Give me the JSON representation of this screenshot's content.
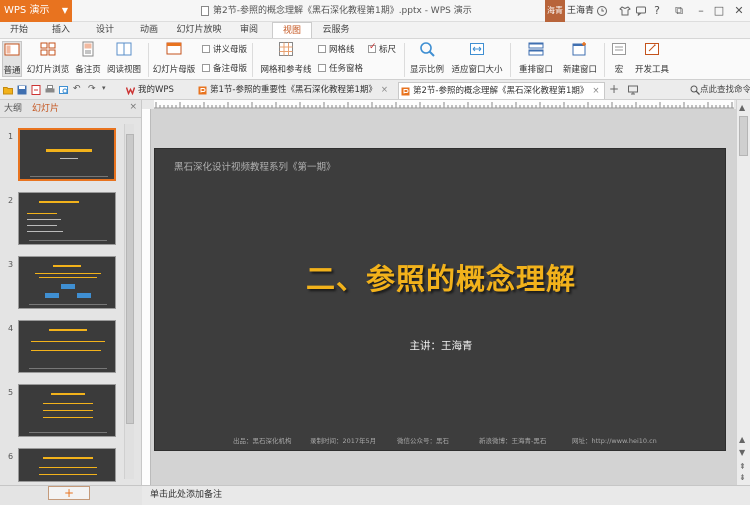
{
  "titlebar": {
    "app_label": "WPS 演示",
    "document_title": "第2节-参照的概念理解《黑石深化教程第1期》.pptx - WPS 演示",
    "avatar_text": "海青",
    "user_name": "王海青"
  },
  "menu": {
    "tabs": [
      "开始",
      "插入",
      "设计",
      "动画",
      "幻灯片放映",
      "审阅",
      "视图",
      "云服务"
    ],
    "active": "视图"
  },
  "ribbon": {
    "normal": "普通",
    "slide_sorter": "幻灯片浏览",
    "notes_page": "备注页",
    "reading_view": "阅读视图",
    "slide_master": "幻灯片母版",
    "handout_master": "讲义母版",
    "notes_master": "备注母版",
    "grid_guides": "网格和参考线",
    "gridlines": "网格线",
    "task_pane": "任务窗格",
    "ruler": "标尺",
    "ruler_checked": true,
    "zoom": "显示比例",
    "fit_window": "适应窗口大小",
    "arrange_windows": "重排窗口",
    "new_window": "新建窗口",
    "macro": "宏",
    "dev_tools": "开发工具"
  },
  "doctabs": {
    "my_wps": "我的WPS",
    "tab1": "第1节-参照的重要性《黑石深化教程第1期》",
    "tab2": "第2节-参照的概念理解《黑石深化教程第1期》",
    "add": "+",
    "search": "点此查找命令"
  },
  "leftpanel": {
    "outline_tab": "大纲",
    "slides_tab": "幻灯片",
    "close": "×",
    "slide_numbers": [
      "1",
      "2",
      "3",
      "4",
      "5",
      "6"
    ],
    "add_slide": "+"
  },
  "slide": {
    "series": "黑石深化设计视频教程系列《第一期》",
    "title": "二、参照的概念理解",
    "speaker": "主讲：王海青",
    "footer": {
      "source": "出品：黑石深化机构",
      "date": "录制时间：2017年5月",
      "wechat": "微信公众号：黑石",
      "author": "新浪微博：王海青-黑石",
      "site": "网址：http://www.hei10.cn"
    }
  },
  "notes": {
    "placeholder": "单击此处添加备注"
  },
  "colors": {
    "accent": "#e8731f",
    "slide_bg": "#3d3d3d",
    "title": "#f2b21b"
  }
}
